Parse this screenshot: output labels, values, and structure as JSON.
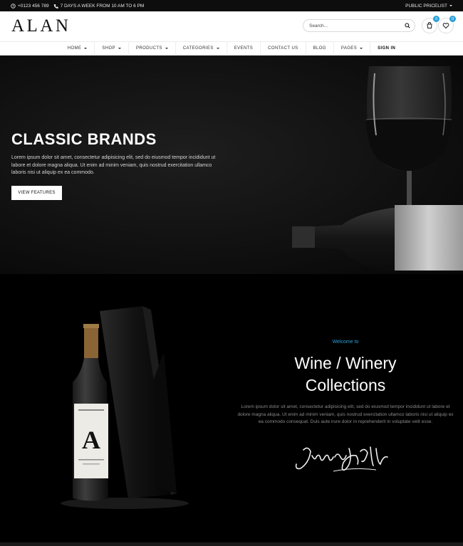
{
  "topbar": {
    "phone": "+0123 456 789",
    "hours": "7 DAYS A WEEK FROM 10 AM TO 6 PM",
    "pricelist": "PUBLIC PRICELIST"
  },
  "header": {
    "logo": "ALAN",
    "search_placeholder": "Search...",
    "cart_count": "0",
    "wishlist_count": "0"
  },
  "nav": {
    "items": [
      {
        "label": "HOME"
      },
      {
        "label": "SHOP"
      },
      {
        "label": "PRODUCTS"
      },
      {
        "label": "CATEGORIES"
      },
      {
        "label": "EVENTS"
      },
      {
        "label": "CONTACT US"
      },
      {
        "label": "BLOG"
      },
      {
        "label": "PAGES"
      },
      {
        "label": "SIGN IN"
      }
    ]
  },
  "hero": {
    "title": "CLASSIC BRANDS",
    "text": "Lorem ipsum dolor sit amet, consectetur adipisicing elit, sed do eiusmod tempor incididunt ut labore et dolore magna aliqua. Ut enim ad minim veniam, quis nostrud exercitation ullamco laboris nisi ut aliquip ex ea commodo.",
    "button": "VIEW FEATURES"
  },
  "section2": {
    "welcome": "Welcome to",
    "title_line1": "Wine / Winery",
    "title_line2": "Collections",
    "text": "Lorem ipsum dolor sit amet, consectetur adipisicing elit, sed do eiusmod tempor incididunt ut labore et dolore magna aliqua. Ut enim ad minim veniam, quis nostrud exercitation ullamco laboris nisi ut aliquip ex ea commodo consequat. Duis aute irure dolor in reprehenderit in voluptate velit esse.",
    "bottle_label_letter": "A"
  },
  "colors": {
    "accent": "#2aa0d8",
    "background": "#000000",
    "header_bg": "#ffffff"
  },
  "icons": [
    "clock-icon",
    "phone-icon",
    "caret-down-icon",
    "search-icon",
    "cart-icon",
    "heart-icon"
  ]
}
